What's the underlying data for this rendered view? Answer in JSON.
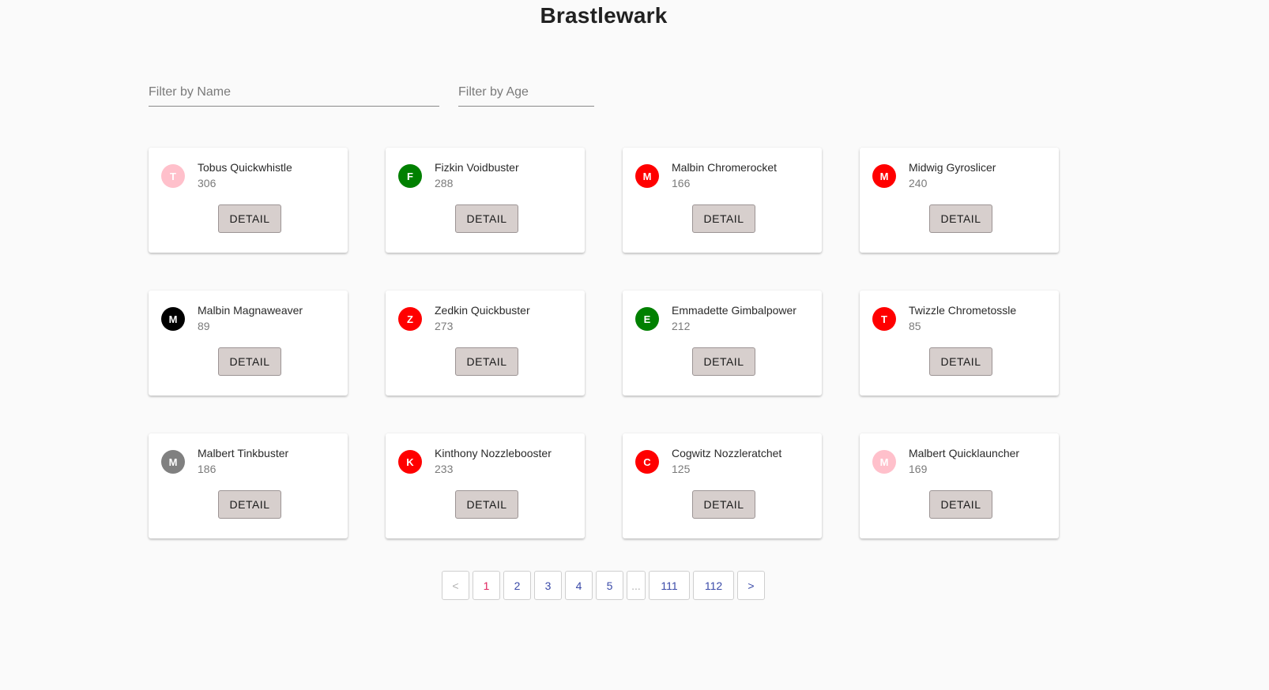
{
  "header": {
    "title": "Brastlewark"
  },
  "filters": {
    "name_placeholder": "Filter by Name",
    "age_placeholder": "Filter by Age"
  },
  "cards": [
    {
      "initial": "T",
      "name": "Tobus Quickwhistle",
      "age": "306",
      "color": "#ffc0cb",
      "button": "DETAIL"
    },
    {
      "initial": "F",
      "name": "Fizkin Voidbuster",
      "age": "288",
      "color": "#008000",
      "button": "DETAIL"
    },
    {
      "initial": "M",
      "name": "Malbin Chromerocket",
      "age": "166",
      "color": "#ff0000",
      "button": "DETAIL"
    },
    {
      "initial": "M",
      "name": "Midwig Gyroslicer",
      "age": "240",
      "color": "#ff0000",
      "button": "DETAIL"
    },
    {
      "initial": "M",
      "name": "Malbin Magnaweaver",
      "age": "89",
      "color": "#000000",
      "button": "DETAIL"
    },
    {
      "initial": "Z",
      "name": "Zedkin Quickbuster",
      "age": "273",
      "color": "#ff0000",
      "button": "DETAIL"
    },
    {
      "initial": "E",
      "name": "Emmadette Gimbalpower",
      "age": "212",
      "color": "#008000",
      "button": "DETAIL"
    },
    {
      "initial": "T",
      "name": "Twizzle Chrometossle",
      "age": "85",
      "color": "#ff0000",
      "button": "DETAIL"
    },
    {
      "initial": "M",
      "name": "Malbert Tinkbuster",
      "age": "186",
      "color": "#808080",
      "button": "DETAIL"
    },
    {
      "initial": "K",
      "name": "Kinthony Nozzlebooster",
      "age": "233",
      "color": "#ff0000",
      "button": "DETAIL"
    },
    {
      "initial": "C",
      "name": "Cogwitz Nozzleratchet",
      "age": "125",
      "color": "#ff0000",
      "button": "DETAIL"
    },
    {
      "initial": "M",
      "name": "Malbert Quicklauncher",
      "age": "169",
      "color": "#ffc0cb",
      "button": "DETAIL"
    }
  ],
  "pagination": {
    "prev": "<",
    "pages": [
      "1",
      "2",
      "3",
      "4",
      "5"
    ],
    "ellipsis": "...",
    "last_pages": [
      "111",
      "112"
    ],
    "next": ">",
    "current": "1"
  }
}
